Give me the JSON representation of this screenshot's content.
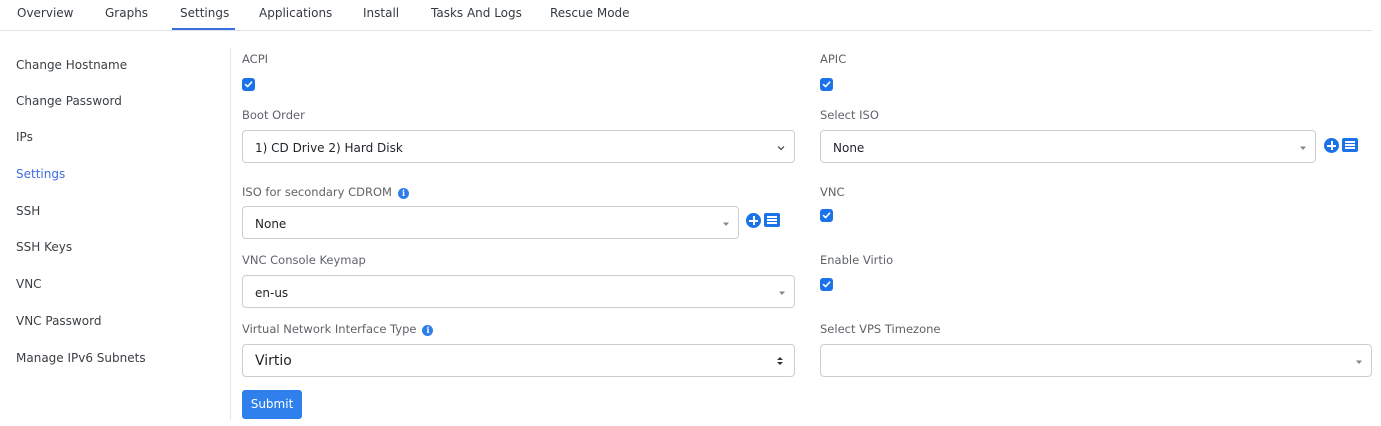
{
  "tabs": [
    "Overview",
    "Graphs",
    "Settings",
    "Applications",
    "Install",
    "Tasks And Logs",
    "Rescue Mode"
  ],
  "active_tab": "Settings",
  "sidebar": {
    "items": [
      "Change Hostname",
      "Change Password",
      "IPs",
      "Settings",
      "SSH",
      "SSH Keys",
      "VNC",
      "VNC Password",
      "Manage IPv6 Subnets"
    ],
    "active": "Settings"
  },
  "form": {
    "acpi": {
      "label": "ACPI",
      "checked": true
    },
    "apic": {
      "label": "APIC",
      "checked": true
    },
    "boot_order": {
      "label": "Boot Order",
      "value": "1) CD Drive 2) Hard Disk"
    },
    "select_iso": {
      "label": "Select ISO",
      "value": "None"
    },
    "secondary_iso": {
      "label": "ISO for secondary CDROM",
      "value": "None"
    },
    "vnc": {
      "label": "VNC",
      "checked": true
    },
    "vnc_keymap": {
      "label": "VNC Console Keymap",
      "value": "en-us"
    },
    "enable_virtio": {
      "label": "Enable Virtio",
      "checked": true
    },
    "nic_type": {
      "label": "Virtual Network Interface Type",
      "value": "Virtio"
    },
    "vps_timezone": {
      "label": "Select VPS Timezone",
      "value": ""
    },
    "submit_label": "Submit"
  },
  "colors": {
    "accent": "#1a73e8",
    "active_text": "#3b6ee0",
    "submit": "#2f80ed"
  },
  "icons": [
    "info-icon",
    "plus-circle-icon",
    "list-icon",
    "chevron-down-icon",
    "caret-down-icon",
    "sort-icon",
    "check-icon"
  ]
}
